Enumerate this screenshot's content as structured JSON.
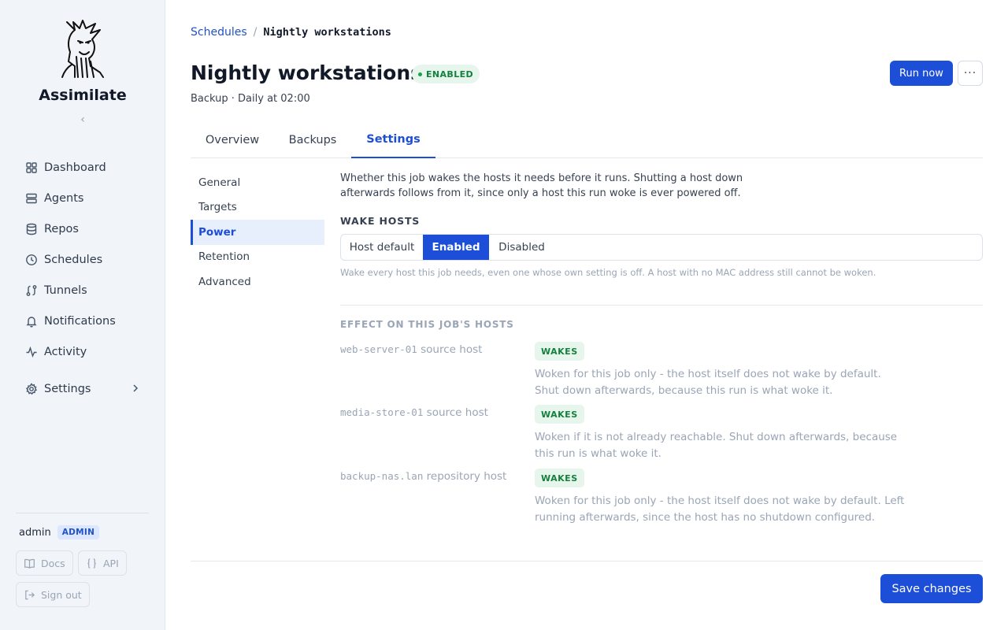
{
  "app": {
    "name": "Assimilate"
  },
  "sidebar": {
    "collapse_glyph": "‹",
    "items": [
      {
        "label": "Dashboard",
        "icon": "grid-icon"
      },
      {
        "label": "Agents",
        "icon": "server-icon"
      },
      {
        "label": "Repos",
        "icon": "database-icon"
      },
      {
        "label": "Schedules",
        "icon": "clock-icon"
      },
      {
        "label": "Tunnels",
        "icon": "route-icon"
      },
      {
        "label": "Notifications",
        "icon": "bell-icon"
      },
      {
        "label": "Activity",
        "icon": "activity-icon"
      }
    ],
    "settings": {
      "label": "Settings",
      "icon": "gear-icon"
    },
    "user": {
      "name": "admin",
      "role": "ADMIN"
    },
    "docs_label": "Docs",
    "api_label": "API",
    "signout_label": "Sign out"
  },
  "header": {
    "breadcrumb": {
      "parent": "Schedules",
      "separator": "/",
      "current": "Nightly workstations"
    },
    "title": "Nightly workstations",
    "status": "ENABLED",
    "subtitle": "Backup · Daily at 02:00",
    "run_label": "Run now",
    "more_label": "···"
  },
  "tabs": [
    {
      "label": "Overview",
      "active": false
    },
    {
      "label": "Backups",
      "active": false
    },
    {
      "label": "Settings",
      "active": true
    }
  ],
  "subnav": [
    {
      "label": "General",
      "active": false
    },
    {
      "label": "Targets",
      "active": false
    },
    {
      "label": "Power",
      "active": true
    },
    {
      "label": "Retention",
      "active": false
    },
    {
      "label": "Advanced",
      "active": false
    }
  ],
  "power": {
    "description": "Whether this job wakes the hosts it needs before it runs. Shutting a host down afterwards follows from it, since only a host this run woke is ever powered off.",
    "wake_label": "WAKE HOSTS",
    "options": [
      {
        "label": "Host default",
        "active": false
      },
      {
        "label": "Enabled",
        "active": true
      },
      {
        "label": "Disabled",
        "active": false
      }
    ],
    "hint": "Wake every host this job needs, even one whose own setting is off. A host with no MAC address still cannot be woken.",
    "effect_label": "EFFECT ON THIS JOB'S HOSTS",
    "hosts": [
      {
        "name": "web-server-01",
        "role": "source host",
        "badge": "WAKES",
        "desc": "Woken for this job only - the host itself does not wake by default. Shut down afterwards, because this run is what woke it."
      },
      {
        "name": "media-store-01",
        "role": "source host",
        "badge": "WAKES",
        "desc": "Woken if it is not already reachable. Shut down afterwards, because this run is what woke it."
      },
      {
        "name": "backup-nas.lan",
        "role": "repository host",
        "badge": "WAKES",
        "desc": "Woken for this job only - the host itself does not wake by default. Left running afterwards, since the host has no shutdown configured."
      }
    ]
  },
  "footer": {
    "save_label": "Save changes"
  },
  "colors": {
    "accent": "#1d4ed8",
    "success": "#15803d",
    "sidebar_bg": "#f1f4f8"
  }
}
